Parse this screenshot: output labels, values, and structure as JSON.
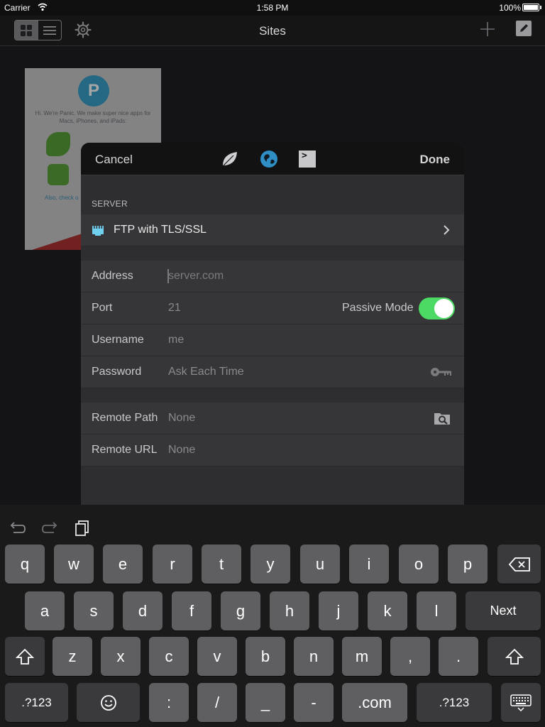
{
  "status_bar": {
    "carrier": "Carrier",
    "time": "1:58 PM",
    "battery": "100%"
  },
  "nav": {
    "title": "Sites",
    "icons": [
      "grid-view-icon",
      "list-view-icon",
      "gear-icon",
      "plus-icon",
      "edit-icon"
    ]
  },
  "site_thumbnail": {
    "text": "Hi. We're Panic. We make super nice apps for Macs, iPhones, and iPads:",
    "link": "Also, check o"
  },
  "modal": {
    "cancel": "Cancel",
    "done": "Done",
    "modes": [
      "leaf-icon",
      "globe-icon",
      "terminal-icon"
    ],
    "server_section": "SERVER",
    "server_type": "FTP with TLS/SSL",
    "fields": {
      "address": {
        "label": "Address",
        "placeholder": "server.com"
      },
      "port": {
        "label": "Port",
        "value": "21"
      },
      "passive_mode": {
        "label": "Passive Mode",
        "on": true
      },
      "username": {
        "label": "Username",
        "value": "me"
      },
      "password": {
        "label": "Password",
        "value": "Ask Each Time"
      },
      "remote_path": {
        "label": "Remote Path",
        "value": "None"
      },
      "remote_url": {
        "label": "Remote URL",
        "value": "None"
      }
    }
  },
  "keyboard": {
    "row1": [
      "q",
      "w",
      "e",
      "r",
      "t",
      "y",
      "u",
      "i",
      "o",
      "p"
    ],
    "row2": [
      "a",
      "s",
      "d",
      "f",
      "g",
      "h",
      "j",
      "k",
      "l"
    ],
    "next": "Next",
    "row3": [
      "z",
      "x",
      "c",
      "v",
      "b",
      "n",
      "m",
      ",",
      "."
    ],
    "row4": {
      "numbers_left": ".?123",
      "colon": ":",
      "slash": "/",
      "underscore": "_",
      "dash": "-",
      "dotcom": ".com",
      "numbers_right": ".?123"
    },
    "colors": {
      "toggle_on": "#4cd964",
      "key": "#5f5f61",
      "key_dark": "#3a3a3c"
    }
  }
}
